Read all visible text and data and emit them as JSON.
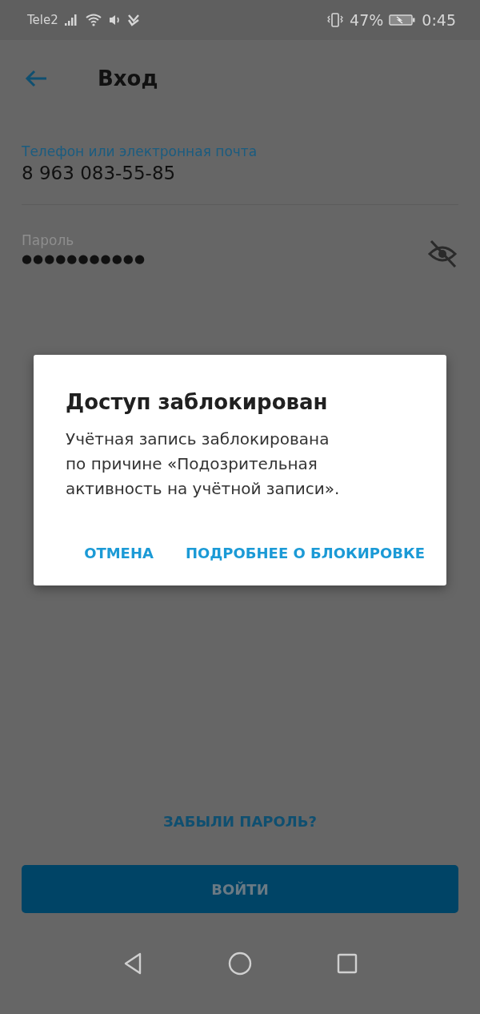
{
  "status_bar": {
    "carrier": "Tele2",
    "battery": "47%",
    "time": "0:45"
  },
  "header": {
    "title": "Вход"
  },
  "phone_field": {
    "label": "Телефон или электронная почта",
    "value": "8 963 083-55-85",
    "focused": true
  },
  "password_field": {
    "label": "Пароль",
    "value": "●●●●●●●●●●●",
    "focused": false
  },
  "dialog": {
    "title": "Доступ заблокирован",
    "message": "Учётная запись заблокирована по причине «Подозрительная активность на учётной записи».",
    "buttons": [
      "ОТМЕНА",
      "ПОДРОБНЕЕ О БЛОКИРОВКЕ"
    ]
  },
  "forgot_link": "ЗАБЫЛИ ПАРОЛЬ?",
  "login_button": {
    "label": "ВОЙТИ",
    "disabled": true
  }
}
